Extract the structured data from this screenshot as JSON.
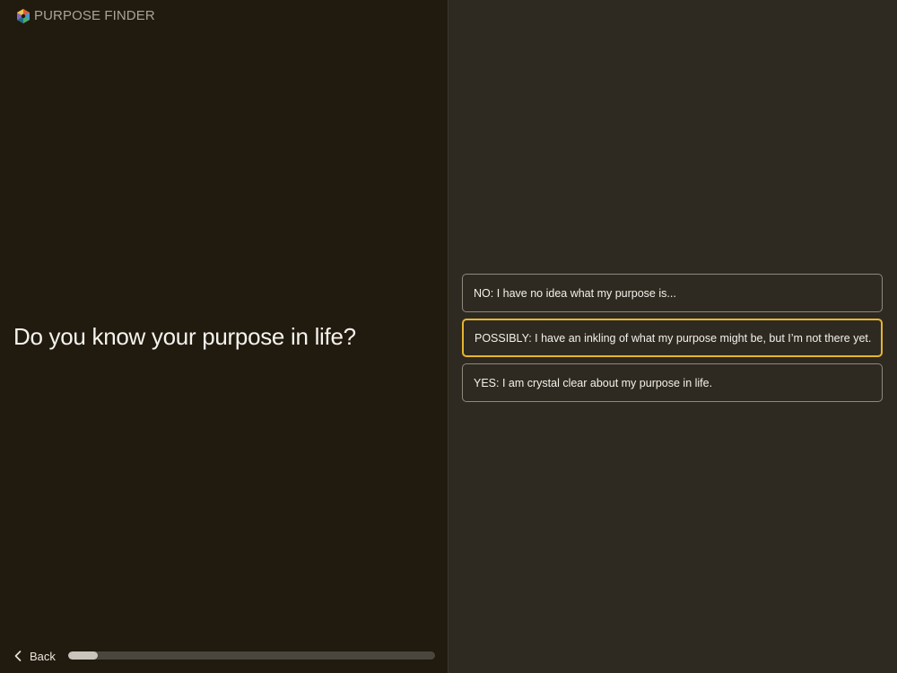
{
  "brand": {
    "name": "PURPOSE FINDER",
    "logo_icon": "compass-logo-icon"
  },
  "question": {
    "text": "Do you know your purpose in life?"
  },
  "options": [
    {
      "label": "NO: I have no idea what my purpose is...",
      "selected": false
    },
    {
      "label": "POSSIBLY: I have an inkling of what my purpose might be, but I’m not there yet.",
      "selected": true
    },
    {
      "label": "YES: I am crystal clear about my purpose in life.",
      "selected": false
    }
  ],
  "footer": {
    "back_label": "Back",
    "back_icon": "chevron-left-icon",
    "progress_percent": 8
  },
  "colors": {
    "accent_selected": "#e7b530",
    "left_panel": "#211a0f",
    "right_panel": "#2e2a21"
  }
}
